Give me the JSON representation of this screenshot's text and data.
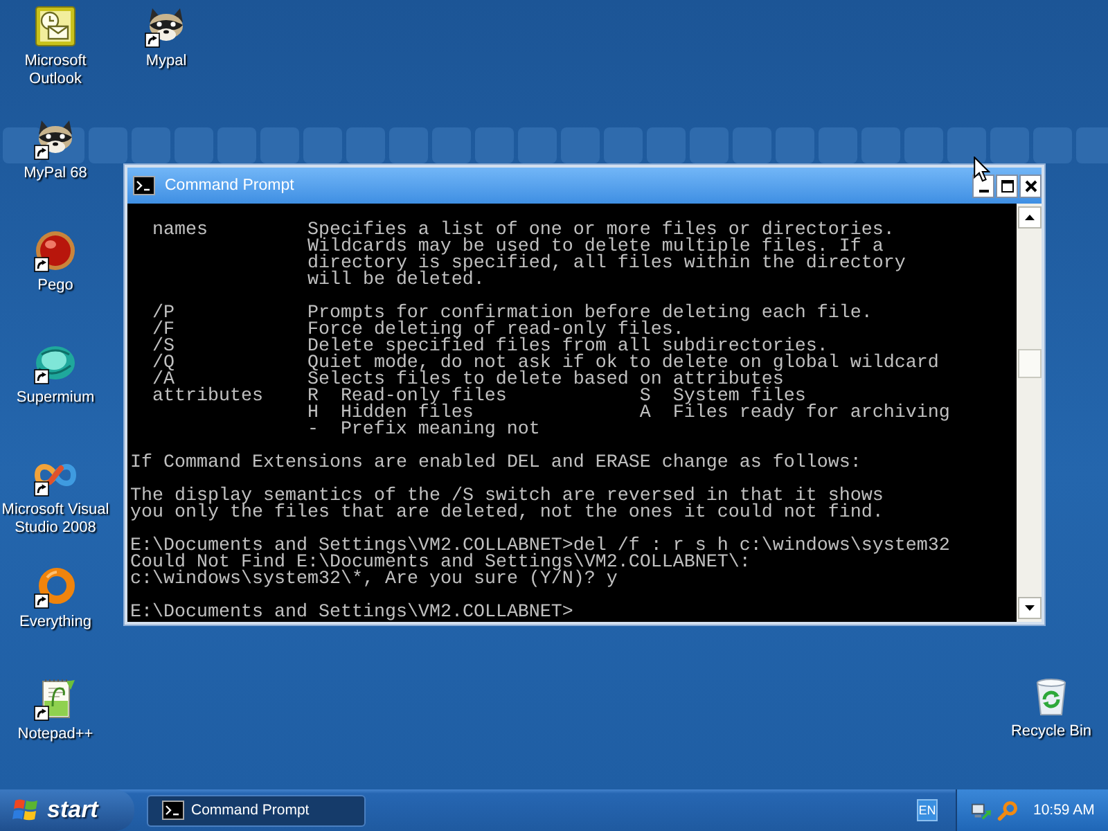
{
  "desktop": {
    "left_column": [
      {
        "label": "Microsoft Outlook",
        "kind": "mail-calendar",
        "shortcut": false
      },
      {
        "label": "MyPal 68",
        "kind": "raccoon",
        "shortcut": true
      },
      {
        "label": "Pego",
        "kind": "ball",
        "shortcut": true
      },
      {
        "label": "Supermium",
        "kind": "globe",
        "shortcut": true
      },
      {
        "label": "Microsoft Visual Studio 2008",
        "kind": "infinity",
        "shortcut": true
      },
      {
        "label": "Everything",
        "kind": "ring",
        "shortcut": true
      },
      {
        "label": "Notepad++",
        "kind": "notepad",
        "shortcut": true
      }
    ],
    "second_column": [
      {
        "label": "Mypal",
        "kind": "raccoon",
        "shortcut": true
      }
    ],
    "right_column": [
      {
        "label": "Recycle Bin",
        "kind": "recycle-bin",
        "shortcut": false
      }
    ]
  },
  "window": {
    "title": "Command Prompt",
    "console": {
      "help_groups": [
        [
          {
            "switch": "names",
            "description": [
              "Specifies a list of one or more files or directories.",
              "Wildcards may be used to delete multiple files. If a",
              "directory is specified, all files within the directory",
              "will be deleted."
            ]
          }
        ],
        [
          {
            "switch": "/P",
            "description": [
              "Prompts for confirmation before deleting each file."
            ]
          },
          {
            "switch": "/F",
            "description": [
              "Force deleting of read-only files."
            ]
          },
          {
            "switch": "/S",
            "description": [
              "Delete specified files from all subdirectories."
            ]
          },
          {
            "switch": "/Q",
            "description": [
              "Quiet mode, do not ask if ok to delete on global wildcard"
            ]
          },
          {
            "switch": "/A",
            "description": [
              "Selects files to delete based on attributes"
            ]
          },
          {
            "switch": "attributes",
            "codes": [
              {
                "code": "R",
                "meaning": "Read-only files"
              },
              {
                "code": "S",
                "meaning": "System files"
              },
              {
                "code": "H",
                "meaning": "Hidden files"
              },
              {
                "code": "A",
                "meaning": "Files ready for archiving"
              },
              {
                "code": "-",
                "meaning": "Prefix meaning not"
              }
            ]
          }
        ]
      ],
      "paragraphs": [
        [
          "If Command Extensions are enabled DEL and ERASE change as follows:"
        ],
        [
          "The display semantics of the /S switch are reversed in that it shows",
          "you only the files that are deleted, not the ones it could not find."
        ]
      ],
      "session": [
        [
          "E:\\Documents and Settings\\VM2.COLLABNET>del /f : r s h c:\\windows\\system32",
          "Could Not Find E:\\Documents and Settings\\VM2.COLLABNET\\:",
          "c:\\windows\\system32\\*, Are you sure (Y/N)? y"
        ],
        [
          "E:\\Documents and Settings\\VM2.COLLABNET>"
        ]
      ]
    }
  },
  "taskbar": {
    "start": "start",
    "tasks": [
      {
        "label": "Command Prompt",
        "selected": true
      }
    ],
    "language": "EN",
    "clock": "10:59 AM"
  }
}
